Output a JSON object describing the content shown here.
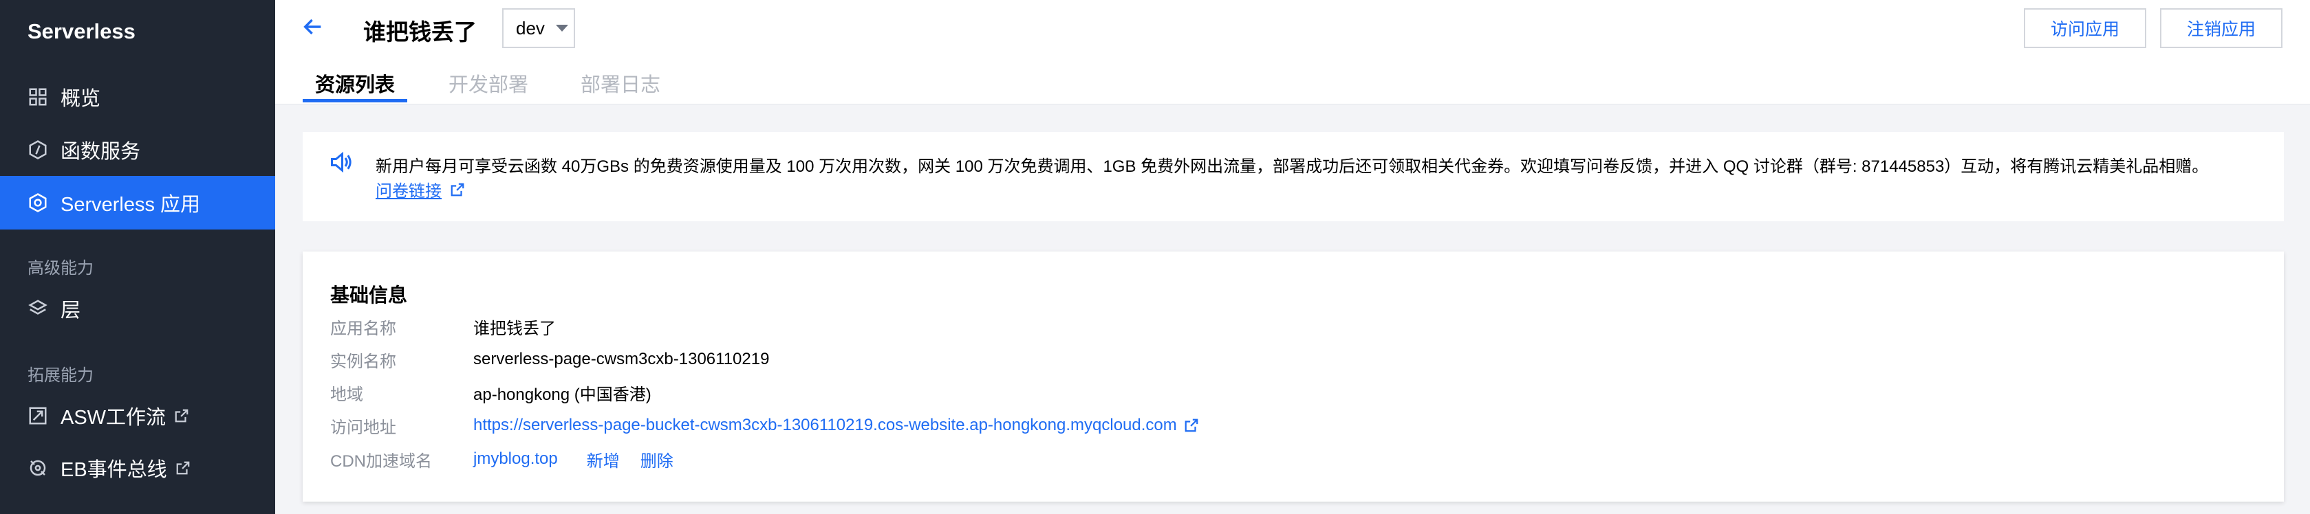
{
  "sidebar": {
    "brand": "Serverless",
    "items": [
      {
        "label": "概览",
        "icon": "grid-icon"
      },
      {
        "label": "函数服务",
        "icon": "function-icon"
      },
      {
        "label": "Serverless 应用",
        "icon": "app-icon",
        "active": true
      }
    ],
    "sections": [
      {
        "title": "高级能力",
        "items": [
          {
            "label": "层",
            "icon": "layers-icon"
          }
        ]
      },
      {
        "title": "拓展能力",
        "items": [
          {
            "label": "ASW工作流",
            "icon": "workflow-icon",
            "external": true
          },
          {
            "label": "EB事件总线",
            "icon": "event-bus-icon",
            "external": true
          }
        ]
      }
    ]
  },
  "header": {
    "title": "谁把钱丢了",
    "env": "dev",
    "visit_button": "访问应用",
    "delete_button": "注销应用",
    "tabs": [
      "资源列表",
      "开发部署",
      "部署日志"
    ]
  },
  "notice": {
    "text": "新用户每月可享受云函数 40万GBs 的免费资源使用量及 100 万次用次数，网关 100 万次免费调用、1GB  免费外网出流量，部署成功后还可领取相关代金券。欢迎填写问卷反馈，并进入 QQ 讨论群（群号: 871445853）互动，将有腾讯云精美礼品相赠。",
    "link": "问卷链接"
  },
  "basic_info": {
    "title": "基础信息",
    "rows": [
      {
        "label": "应用名称",
        "value": "谁把钱丢了"
      },
      {
        "label": "实例名称",
        "value": "serverless-page-cwsm3cxb-1306110219"
      },
      {
        "label": "地域",
        "value": "ap-hongkong (中国香港)"
      },
      {
        "label": "访问地址",
        "value": "https://serverless-page-bucket-cwsm3cxb-1306110219.cos-website.ap-hongkong.myqcloud.com"
      },
      {
        "label": "CDN加速域名",
        "value": "jmyblog.top",
        "actions": [
          "新增",
          "删除"
        ]
      }
    ]
  },
  "colors": {
    "sidebar_bg": "#202733",
    "accent": "#1f6cf3",
    "page_bg": "#f3f4f7"
  }
}
